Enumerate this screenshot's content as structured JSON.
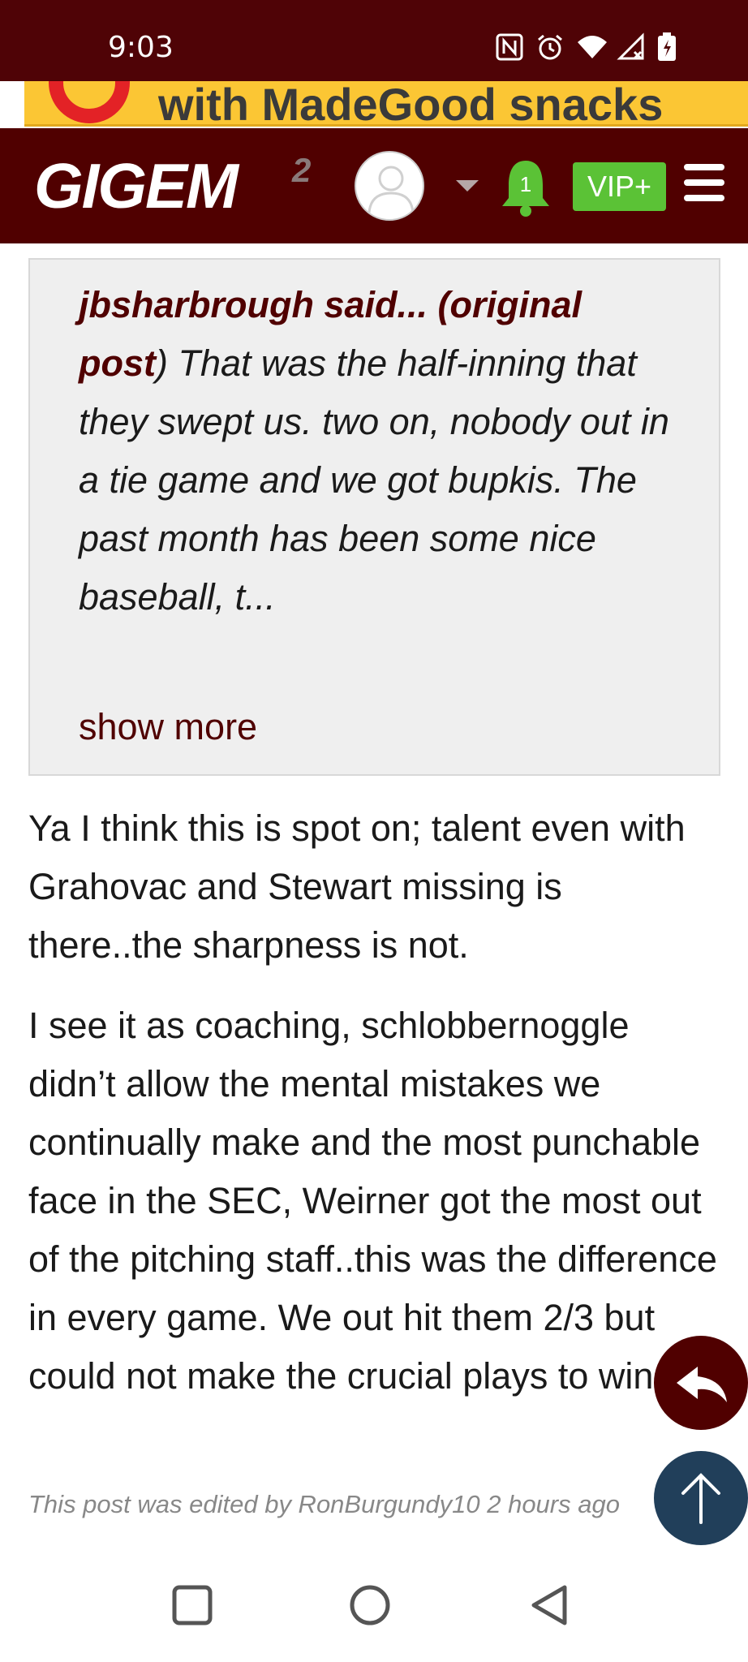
{
  "status_bar": {
    "time": "9:03",
    "icons": [
      "nfc-icon",
      "alarm-icon",
      "wifi-icon",
      "signal-icon",
      "battery-icon"
    ]
  },
  "ad": {
    "text": "with MadeGood snacks",
    "brand_color": "#fbc634"
  },
  "header": {
    "logo_main": "GIGEM",
    "logo_sup": "2",
    "notification_count": "1",
    "vip_label": "VIP+",
    "background": "#500000"
  },
  "quote": {
    "author": "jbsharbrough said... (original post",
    "text_after_author": ") That was the half-inning that they swept us. two on, nobody out in a tie game and we got bupkis. The past month has been some nice baseball, t...",
    "show_more": "show more"
  },
  "post": {
    "paragraph1": "Ya I think this is spot on; talent even with Grahovac and Stewart missing is there..the sharpness is not.",
    "paragraph2": "I see it as coaching, schlobbernoggle didn’t allow the mental mistakes we continually make and the most punchable face in the SEC, Weirner got the most out of the pitching staff..this was the difference in every game. We out hit them 2/3 but could not make the crucial plays to win...",
    "edit_note": "This post was edited by RonBurgundy10 2 hours ago"
  },
  "floating_buttons": {
    "reply_color": "#500000",
    "top_color": "#213f5a"
  },
  "nav": {
    "buttons": [
      "recents-button",
      "home-button",
      "back-button"
    ]
  }
}
